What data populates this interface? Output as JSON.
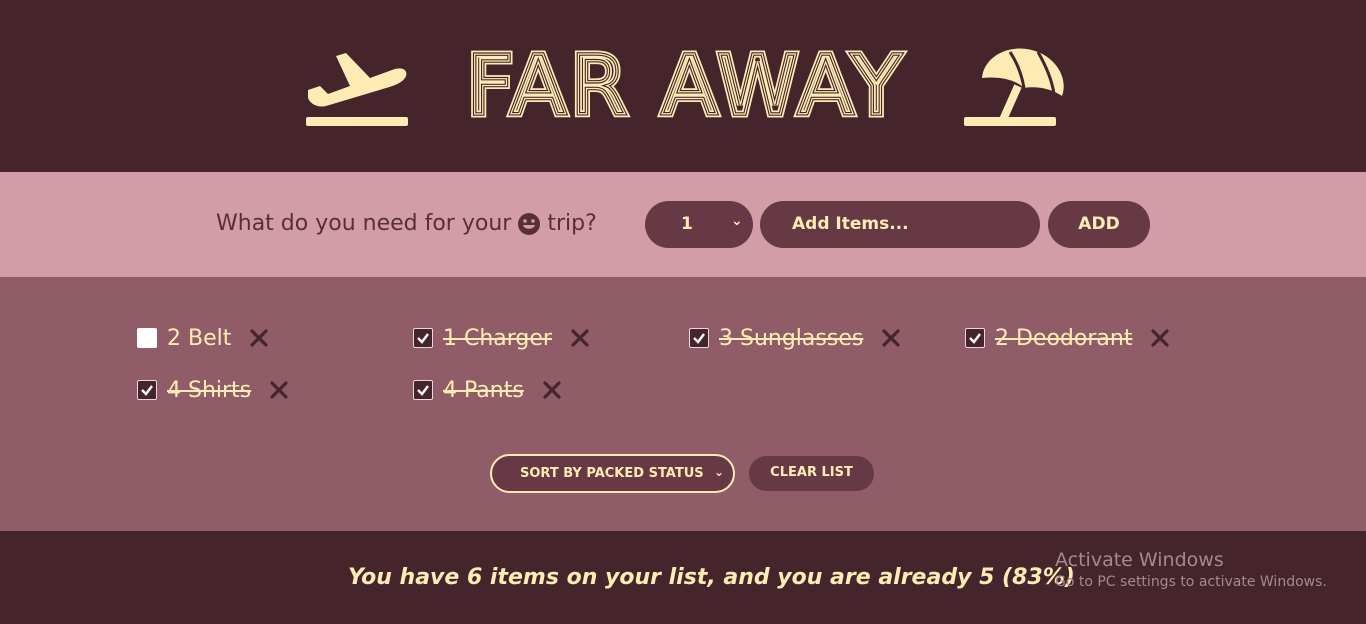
{
  "colors": {
    "dark": "#45242c",
    "pink": "#d29da7",
    "mauve": "#8f5c67",
    "control": "#673945",
    "cream": "#ffebb3"
  },
  "header": {
    "title": "FAR AWAY",
    "left_icon": "airplane-departure-icon",
    "right_icon": "beach-umbrella-icon"
  },
  "add_form": {
    "prompt_before": "What do you need for your",
    "prompt_emoji": "grinning-face-icon",
    "prompt_after": "trip?",
    "quantity_value": "1",
    "item_placeholder": "Add Items...",
    "add_label": "ADD"
  },
  "list": {
    "items": [
      {
        "label": "2 Belt",
        "packed": false
      },
      {
        "label": "1 Charger",
        "packed": true
      },
      {
        "label": "3 Sunglasses",
        "packed": true
      },
      {
        "label": "2 Deodorant",
        "packed": true
      },
      {
        "label": "4 Shirts",
        "packed": true
      },
      {
        "label": "4 Pants",
        "packed": true
      }
    ],
    "delete_icon": "close-x-icon"
  },
  "actions": {
    "sort_value": "SORT BY PACKED STATUS",
    "clear_label": "CLEAR LIST"
  },
  "stats": {
    "text": "You have 6 items on your list, and you are already 5 (83%)"
  },
  "os_overlay": {
    "title": "Activate Windows",
    "subtitle": "Go to PC settings to activate Windows."
  }
}
